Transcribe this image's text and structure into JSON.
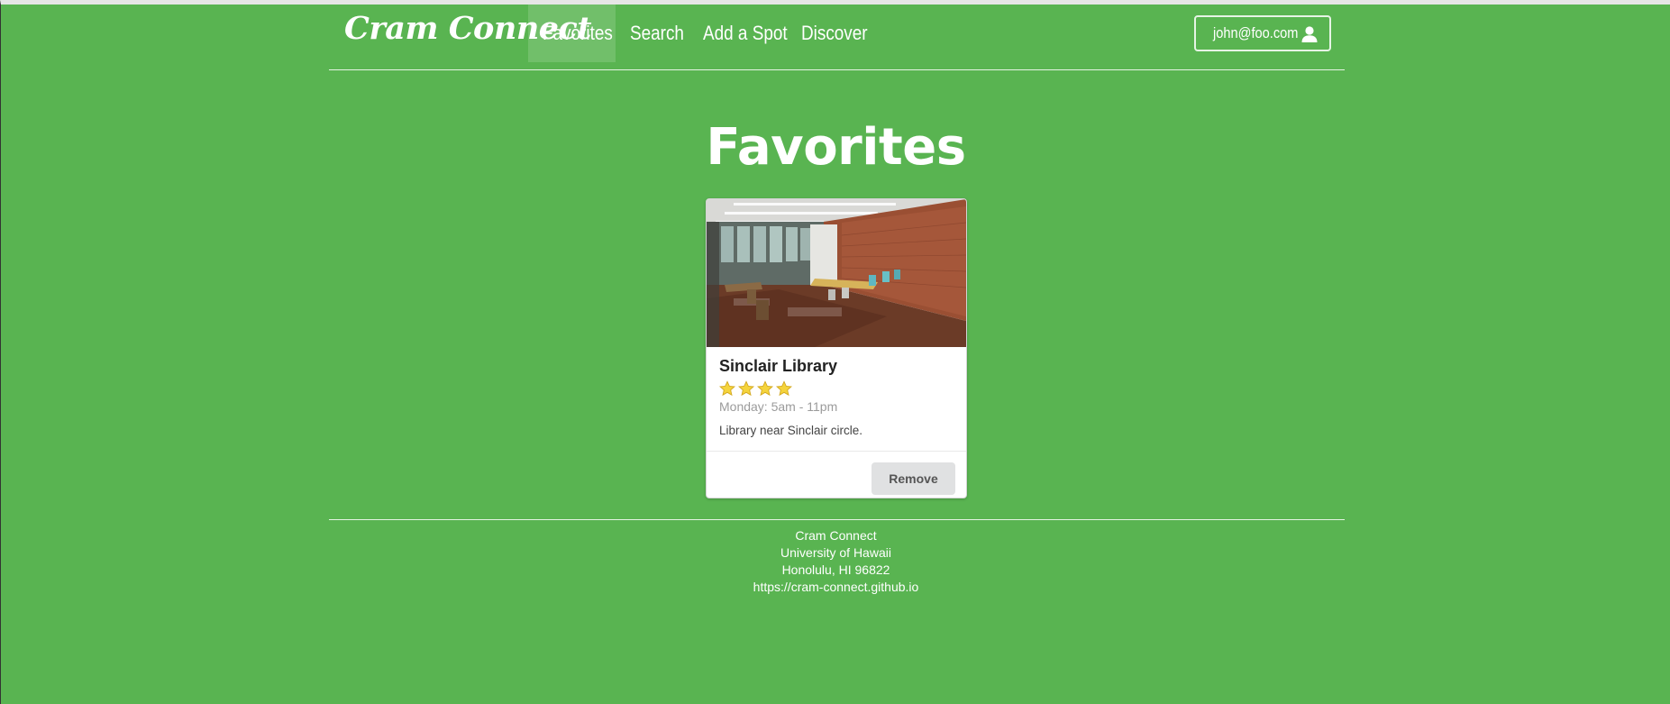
{
  "nav": {
    "brand": "Cram Connect",
    "items": [
      {
        "label": "Favorites",
        "active": true
      },
      {
        "label": "Search",
        "active": false
      },
      {
        "label": "Add a Spot",
        "active": false
      },
      {
        "label": "Discover",
        "active": false
      }
    ],
    "user_email": "john@foo.com",
    "user_icon": "user-icon"
  },
  "page": {
    "title": "Favorites"
  },
  "favorites": [
    {
      "name": "Sinclair Library",
      "rating": 4,
      "rating_icon": "star-icon",
      "hours": "Monday: 5am - 11pm",
      "description": "Library near Sinclair circle.",
      "action_label": "Remove"
    }
  ],
  "footer": {
    "lines": [
      "Cram Connect",
      "University of Hawaii",
      "Honolulu, HI 96822",
      "https://cram-connect.github.io"
    ]
  },
  "colors": {
    "background": "#59b451",
    "star": "#f5d43c",
    "button_bg": "#e0e1e2"
  }
}
